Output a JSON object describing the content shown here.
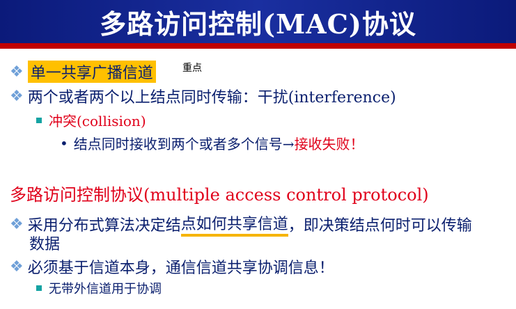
{
  "title": "多路访问控制(MAC)协议",
  "b1": {
    "text": "单一共享广播信道",
    "note": "重点"
  },
  "b2": {
    "text": "两个或者两个以上结点同时传输：干扰(interference)"
  },
  "b3": {
    "text": "冲突(collision)"
  },
  "b4": {
    "pre": "结点同时接收到两个或者多个信号→",
    "red": "接收失败",
    "post": "！"
  },
  "heading": "多路访问控制协议(multiple access control protocol)",
  "b5": {
    "pre": "采用分布式算法决定结",
    "underlined": "点如何共享信道",
    "post": "，即决策结点何时可以传输",
    "wrap": "数据"
  },
  "b6": {
    "text": "必须基于信道本身，通信信道共享协调信息！"
  },
  "b7": {
    "text": "无带外信道用于协调"
  },
  "colors": {
    "title_bg": "#0b1a7a",
    "rule": "#c00000",
    "text": "#0a1f6e",
    "accent_red": "#e0001a",
    "highlight": "#ffc000"
  }
}
